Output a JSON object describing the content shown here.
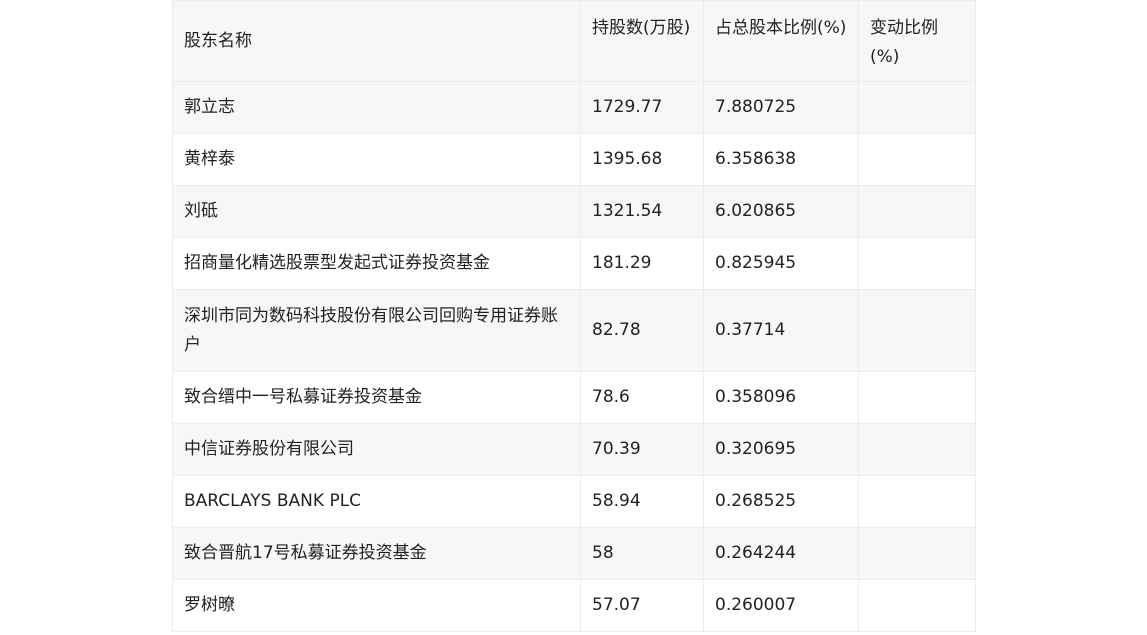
{
  "table": {
    "headers": [
      "股东名称",
      "持股数(万股)",
      "占总股本比例(%)",
      "变动比例(%)"
    ],
    "rows": [
      {
        "name": "郭立志",
        "shares": "1729.77",
        "ratio": "7.880725",
        "change": ""
      },
      {
        "name": "黄梓泰",
        "shares": "1395.68",
        "ratio": "6.358638",
        "change": ""
      },
      {
        "name": "刘砥",
        "shares": "1321.54",
        "ratio": "6.020865",
        "change": ""
      },
      {
        "name": "招商量化精选股票型发起式证券投资基金",
        "shares": "181.29",
        "ratio": "0.825945",
        "change": ""
      },
      {
        "name": "深圳市同为数码科技股份有限公司回购专用证券账户",
        "shares": "82.78",
        "ratio": "0.37714",
        "change": ""
      },
      {
        "name": "致合缙中一号私募证券投资基金",
        "shares": "78.6",
        "ratio": "0.358096",
        "change": ""
      },
      {
        "name": "中信证券股份有限公司",
        "shares": "70.39",
        "ratio": "0.320695",
        "change": ""
      },
      {
        "name": "BARCLAYS BANK PLC",
        "shares": "58.94",
        "ratio": "0.268525",
        "change": ""
      },
      {
        "name": "致合晋航17号私募证券投资基金",
        "shares": "58",
        "ratio": "0.264244",
        "change": ""
      },
      {
        "name": "罗树暸",
        "shares": "57.07",
        "ratio": "0.260007",
        "change": ""
      }
    ]
  }
}
